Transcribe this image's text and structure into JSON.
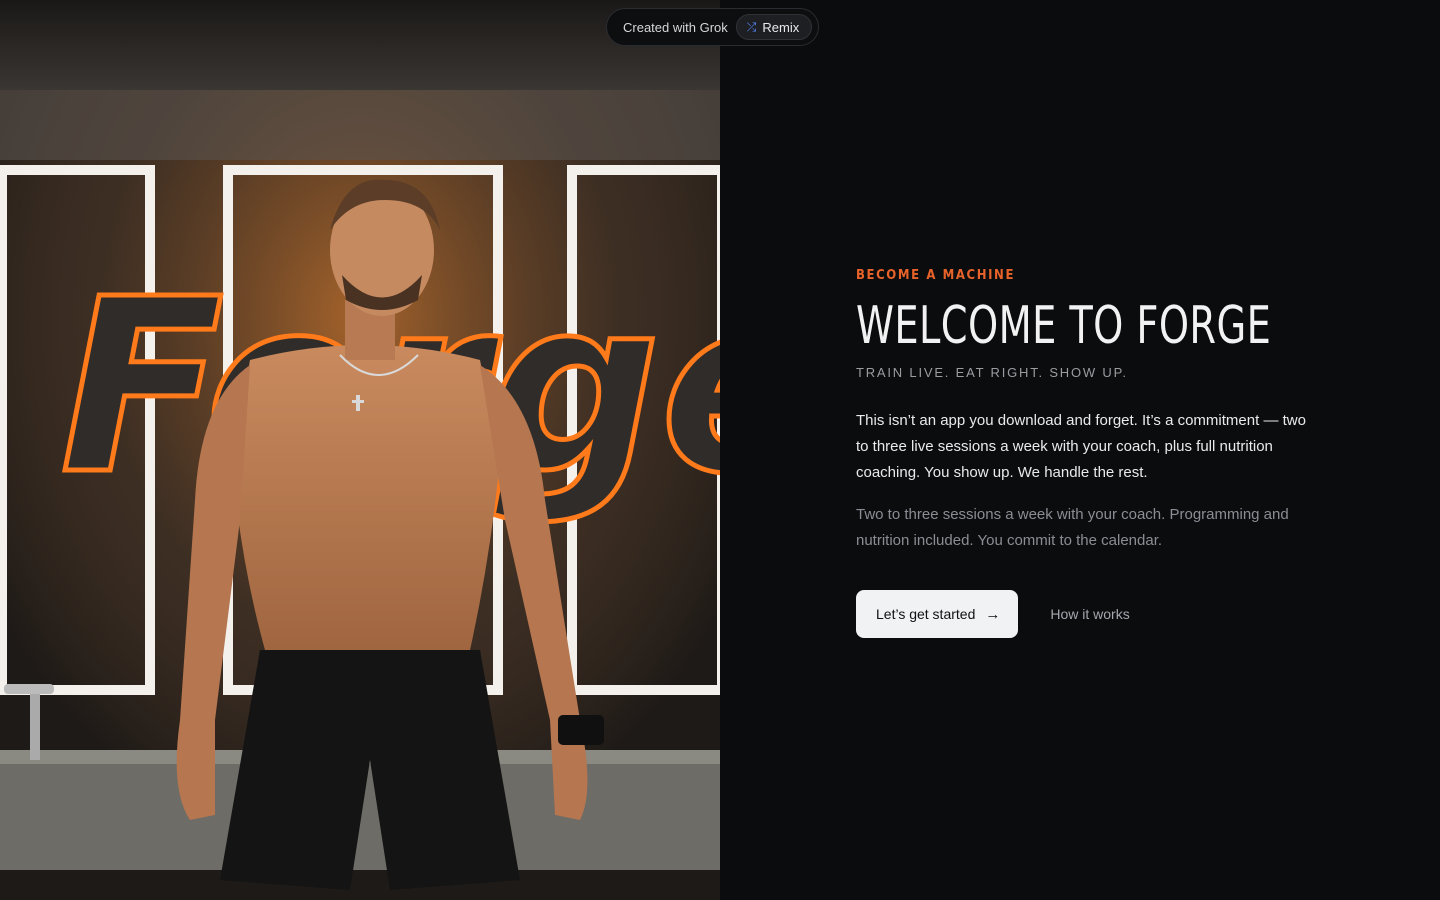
{
  "badge": {
    "text": "Created with Grok",
    "remix_label": "Remix",
    "remix_icon": "shuffle-icon"
  },
  "hero": {
    "image_description_icon": "hero-photo",
    "logo_text": "Forge"
  },
  "content": {
    "eyebrow": "BECOME A MACHINE",
    "title": "WELCOME TO FORGE",
    "tagline": "TRAIN LIVE. EAT RIGHT. SHOW UP.",
    "lead": "This isn’t an app you download and forget. It’s a commitment — two to three live sessions a week with your coach, plus full nutrition coaching. You show up. We handle the rest.",
    "sub": "Two to three sessions a week with your coach. Programming and nutrition included. You commit to the calendar.",
    "primary_cta": "Let’s get started",
    "primary_cta_icon": "arrow-right-icon",
    "secondary_cta": "How it works"
  },
  "colors": {
    "accent": "#e8632a",
    "background": "#0b0c0e",
    "primary_button": "#f1f2f4"
  }
}
